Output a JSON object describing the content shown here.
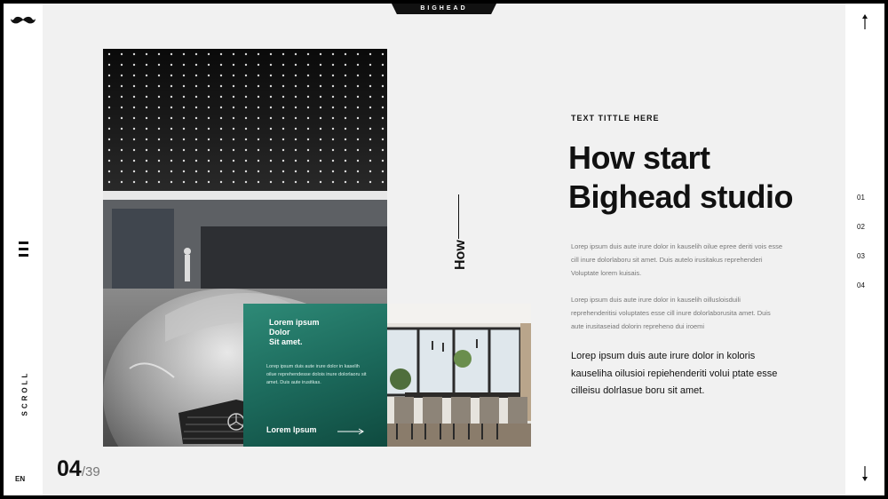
{
  "brand": {
    "name": "BIGHEAD"
  },
  "sidebar_left": {
    "scroll_label": "SCROLL",
    "language": "EN",
    "logo_icon": "mustache-icon",
    "menu_icon": "hamburger-icon"
  },
  "sidebar_right": {
    "nav_numbers": [
      "01",
      "02",
      "03",
      "04"
    ],
    "up_icon": "arrow-up-icon",
    "down_icon": "arrow-down-icon"
  },
  "card": {
    "title_lines": [
      "Lorem ipsum",
      "Dolor",
      "Sit amet."
    ],
    "text": "Lorep ipsum duis aute irure dolor in kaselih oilue reprehendesse dolois inure dolorlaoru sit amet. Duis aute irusitkas.",
    "link_label": "Lorem Ipsum",
    "link_icon": "arrow-right-icon"
  },
  "vertical_label": "How",
  "content": {
    "subtitle": "TEXT TITTLE HERE",
    "heading_lines": [
      "How start",
      "Bighead studio"
    ],
    "para1": "Lorep ipsum duis aute irure dolor in kauselih oilue epree deriti vois esse cill inure dolorlaboru sit amet. Duis autelo irusitakus reprehenderi Voluptate lorem kuisais.",
    "para2": "Lorep ipsum duis aute irure dolor in kauselih oillusloisduili reprehenderitisi voluptates esse cill inure dolorlaborusita amet. Duis aute irusitaseiad dolorin repreheno dui iroemi",
    "para3": "Lorep ipsum duis aute irure dolor in koloris kauseliha oilusioi repiehenderiti volui ptate esse cilleisu dolrlasue boru sit amet."
  },
  "pagination": {
    "current": "04",
    "total": "/39"
  },
  "colors": {
    "accent": "#1f6f60",
    "background": "#f1f1f1",
    "sidebar": "#ffffff",
    "text": "#111111"
  }
}
